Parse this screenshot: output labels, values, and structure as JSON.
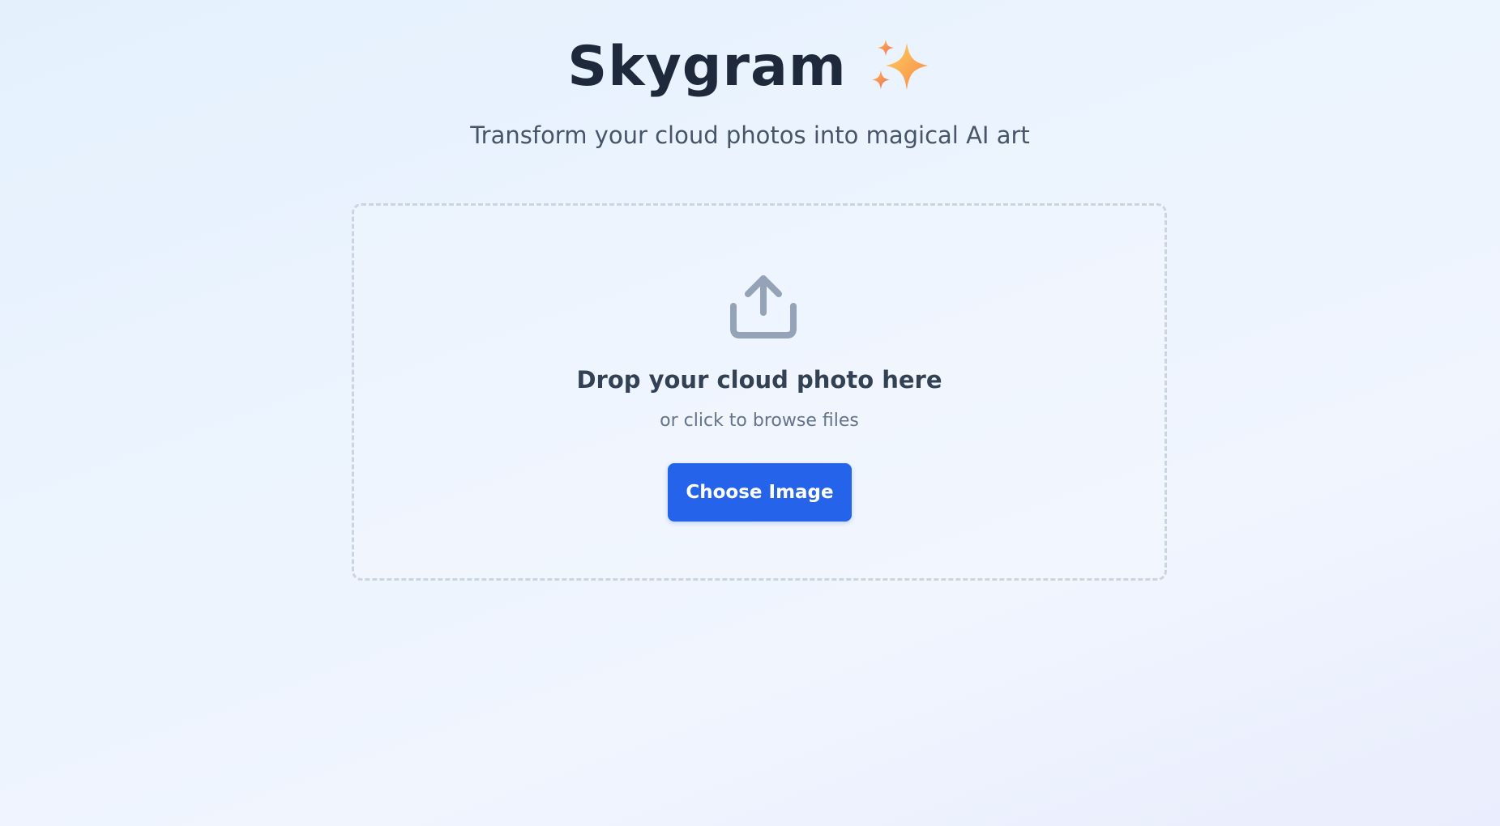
{
  "header": {
    "title": "Skygram",
    "title_icon": "sparkles-icon",
    "subtitle": "Transform your cloud photos into magical AI art"
  },
  "dropzone": {
    "icon": "upload-icon",
    "title": "Drop your cloud photo here",
    "subtitle": "or click to browse files",
    "button_label": "Choose Image"
  },
  "colors": {
    "accent": "#2563eb",
    "title": "#1e293b",
    "icon": "#94a3b8",
    "border": "#cbd5e1"
  }
}
